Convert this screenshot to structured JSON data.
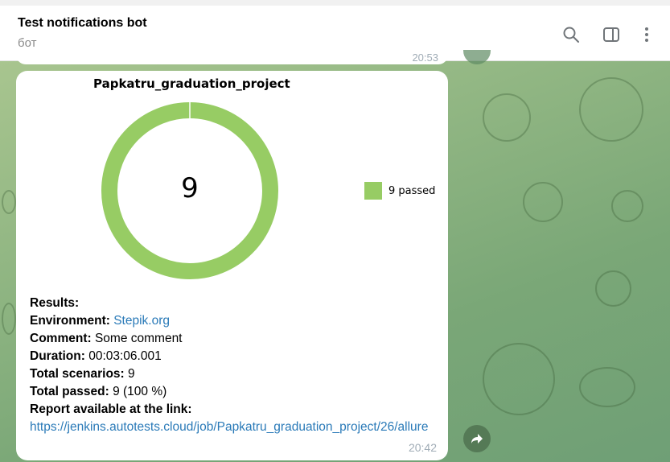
{
  "header": {
    "title": "Test notifications bot",
    "subtitle": "бот",
    "icons": [
      "search-icon",
      "sidebar-toggle-icon",
      "more-vertical-icon"
    ]
  },
  "previous_message": {
    "time": "20:53"
  },
  "message": {
    "time": "20:42",
    "chart": {
      "title": "Papkatru_graduation_project",
      "center_value": "9",
      "legend_label": "9 passed"
    },
    "results_heading": "Results:",
    "environment_label": "Environment:",
    "environment_value": "Stepik.org",
    "comment_label": "Comment:",
    "comment_value": "Some comment",
    "duration_label": "Duration:",
    "duration_value": "00:03:06.001",
    "total_scenarios_label": "Total scenarios:",
    "total_scenarios_value": "9",
    "total_passed_label": "Total passed:",
    "total_passed_value": "9 (100 %)",
    "report_label": "Report available at the link:",
    "report_link": "https://jenkins.autotests.cloud/job/Papkatru_graduation_project/26/allure"
  },
  "colors": {
    "passed": "#97cc64",
    "link": "#2a7ab8",
    "time": "#a0acb6"
  },
  "chart_data": {
    "type": "pie",
    "title": "Papkatru_graduation_project",
    "categories": [
      "passed"
    ],
    "values": [
      9
    ],
    "legend": [
      "9 passed"
    ],
    "legend_position": "right",
    "center_label": "9"
  }
}
